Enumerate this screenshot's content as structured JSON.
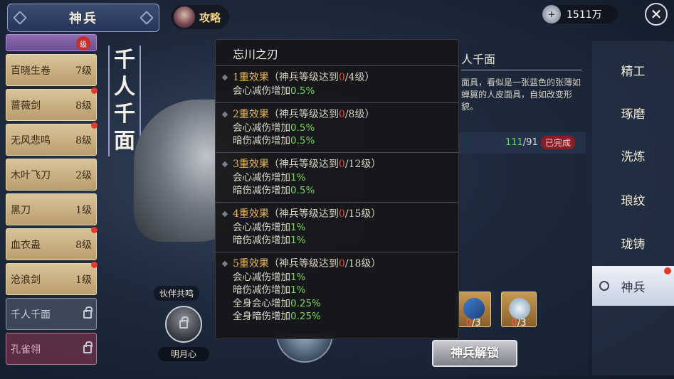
{
  "header": {
    "title": "神兵",
    "guide_label": "攻略",
    "currency_value": "1511万",
    "currency_icon": "silver-coin-icon"
  },
  "weapon_list": [
    {
      "name": "",
      "level": "",
      "state": "partial",
      "badge": "级"
    },
    {
      "name": "百晓生卷",
      "level": "7级",
      "state": "normal",
      "dot": false
    },
    {
      "name": "蔷薇剑",
      "level": "8级",
      "state": "normal",
      "dot": true
    },
    {
      "name": "无风悲鸣",
      "level": "8级",
      "state": "normal",
      "dot": true
    },
    {
      "name": "木叶飞刀",
      "level": "2级",
      "state": "normal",
      "dot": false
    },
    {
      "name": "黑刀",
      "level": "1级",
      "state": "normal",
      "dot": false
    },
    {
      "name": "血衣蛊",
      "level": "8级",
      "state": "normal",
      "dot": true
    },
    {
      "name": "沧浪剑",
      "level": "1级",
      "state": "normal",
      "dot": true
    },
    {
      "name": "千人千面",
      "level": "",
      "state": "locked",
      "dot": false
    },
    {
      "name": "孔雀翎",
      "level": "",
      "state": "locked2",
      "dot": false
    }
  ],
  "selected_weapon": {
    "vertical_name": [
      "千",
      "人",
      "千",
      "面"
    ],
    "detail_title": "人千面",
    "detail_desc": "面具，看似是一张蓝色的张薄如蝉翼的人皮面具，自如改变形貌。",
    "progress_current": "111",
    "progress_total": "/91",
    "done_label": "已完成"
  },
  "partner": {
    "label": "伙伴共鸣",
    "name": "明月心"
  },
  "materials": [
    {
      "count_have": "0",
      "count_need": "/3",
      "icon": "scroll-icon"
    },
    {
      "count_have": "0",
      "count_need": "/3",
      "icon": "pearl-icon"
    }
  ],
  "unlock_button": "神兵解锁",
  "tabs": [
    {
      "label": "精工",
      "active": false
    },
    {
      "label": "琢磨",
      "active": false
    },
    {
      "label": "洗炼",
      "active": false
    },
    {
      "label": "琅纹",
      "active": false
    },
    {
      "label": "珑铸",
      "active": false
    },
    {
      "label": "神兵",
      "active": true,
      "dot": true
    }
  ],
  "tooltip": {
    "title": "忘川之刃",
    "tiers": [
      {
        "name": "1重效果",
        "req_prefix": "（神兵等级达到",
        "req_cur": "0",
        "req_max": "/4级）",
        "effects": [
          {
            "text": "会心减伤增加",
            "value": "0.5%"
          }
        ]
      },
      {
        "name": "2重效果",
        "req_prefix": "（神兵等级达到",
        "req_cur": "0",
        "req_max": "/8级）",
        "effects": [
          {
            "text": "会心减伤增加",
            "value": "0.5%"
          },
          {
            "text": "暗伤减伤增加",
            "value": "0.5%"
          }
        ]
      },
      {
        "name": "3重效果",
        "req_prefix": "（神兵等级达到",
        "req_cur": "0",
        "req_max": "/12级）",
        "effects": [
          {
            "text": "会心减伤增加",
            "value": "1%"
          },
          {
            "text": "暗伤减伤增加",
            "value": "0.5%"
          }
        ]
      },
      {
        "name": "4重效果",
        "req_prefix": "（神兵等级达到",
        "req_cur": "0",
        "req_max": "/15级）",
        "effects": [
          {
            "text": "会心减伤增加",
            "value": "1%"
          },
          {
            "text": "暗伤减伤增加",
            "value": "1%"
          }
        ]
      },
      {
        "name": "5重效果",
        "req_prefix": "（神兵等级达到",
        "req_cur": "0",
        "req_max": "/18级）",
        "effects": [
          {
            "text": "会心减伤增加",
            "value": "1%"
          },
          {
            "text": "暗伤减伤增加",
            "value": "1%"
          },
          {
            "text": "全身会心增加",
            "value": "0.25%"
          },
          {
            "text": "全身暗伤增加",
            "value": "0.25%"
          }
        ]
      }
    ]
  }
}
